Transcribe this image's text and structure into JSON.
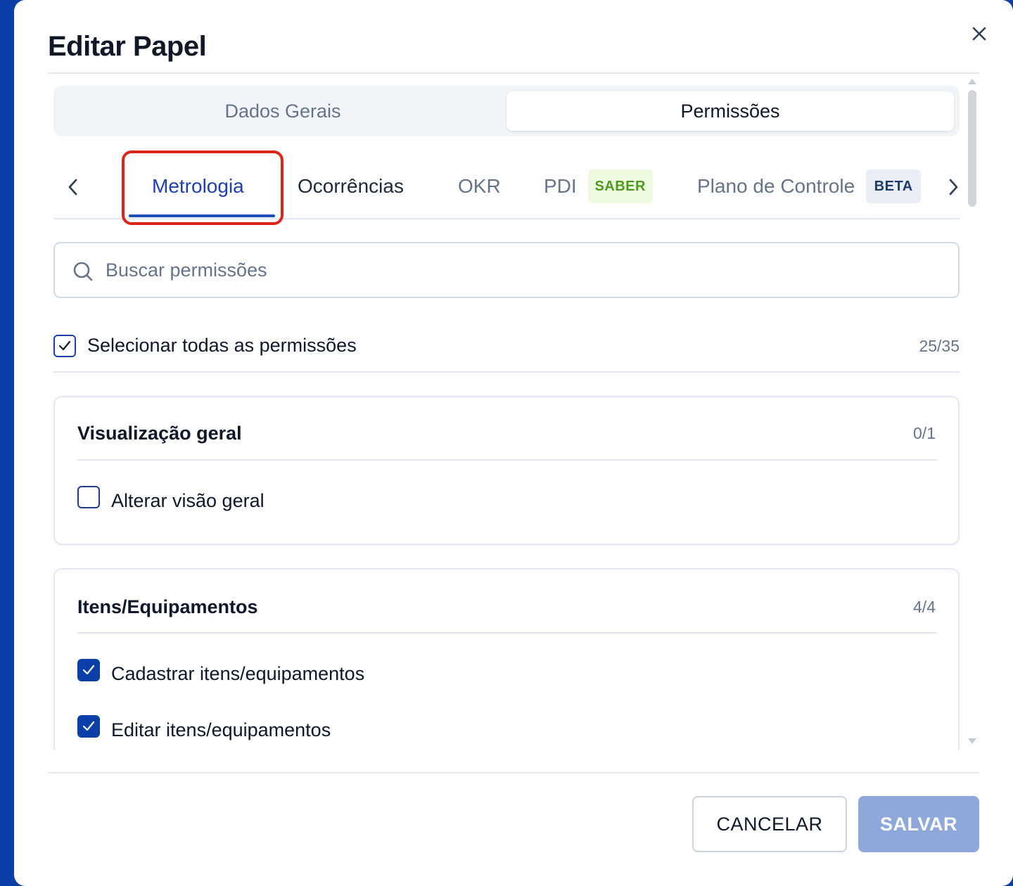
{
  "dialog": {
    "title": "Editar Papel"
  },
  "segmented": {
    "tabs": [
      {
        "label": "Dados Gerais",
        "active": false
      },
      {
        "label": "Permissões",
        "active": true
      }
    ]
  },
  "modules": {
    "tabs": [
      {
        "label": "Metrologia",
        "active": true
      },
      {
        "label": "Ocorrências"
      },
      {
        "label": "OKR"
      },
      {
        "label": "PDI",
        "badge": "SABER"
      },
      {
        "label": "Plano de Controle",
        "badge": "BETA"
      }
    ]
  },
  "search": {
    "placeholder": "Buscar permissões",
    "value": ""
  },
  "select_all": {
    "label": "Selecionar todas as permissões",
    "count": "25/35",
    "checked": true
  },
  "groups": [
    {
      "title": "Visualização geral",
      "count": "0/1",
      "items": [
        {
          "label": "Alterar visão geral",
          "checked": false
        }
      ]
    },
    {
      "title": "Itens/Equipamentos",
      "count": "4/4",
      "items": [
        {
          "label": "Cadastrar itens/equipamentos",
          "checked": true
        },
        {
          "label": "Editar itens/equipamentos",
          "checked": true
        }
      ]
    }
  ],
  "footer": {
    "cancel_label": "CANCELAR",
    "save_label": "SALVAR"
  },
  "colors": {
    "accent": "#0b3fa8",
    "highlight": "#dc2418",
    "save_disabled": "#8ea8dc"
  }
}
